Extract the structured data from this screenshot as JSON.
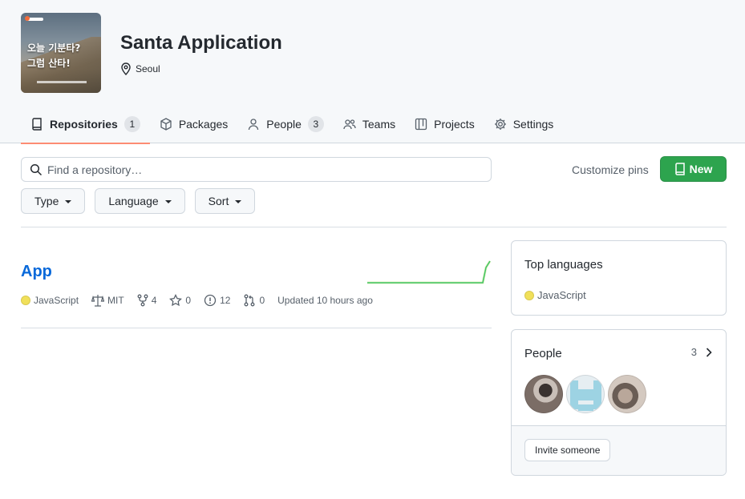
{
  "org": {
    "name": "Santa Application",
    "location": "Seoul",
    "avatar_text": [
      "오늘 기분타?",
      "그럼 산타!"
    ]
  },
  "tabs": [
    {
      "label": "Repositories",
      "count": "1",
      "icon": "repo-icon",
      "selected": true
    },
    {
      "label": "Packages",
      "icon": "package-icon"
    },
    {
      "label": "People",
      "count": "3",
      "icon": "person-icon"
    },
    {
      "label": "Teams",
      "icon": "people-icon"
    },
    {
      "label": "Projects",
      "icon": "table-icon"
    },
    {
      "label": "Settings",
      "icon": "gear-icon"
    }
  ],
  "search": {
    "placeholder": "Find a repository…"
  },
  "actions": {
    "customize": "Customize pins",
    "new": "New"
  },
  "filters": {
    "type": "Type",
    "language": "Language",
    "sort": "Sort"
  },
  "repo": {
    "name": "App",
    "language": "JavaScript",
    "license": "MIT",
    "forks": "4",
    "stars": "0",
    "issues": "12",
    "pulls": "0",
    "updated": "Updated 10 hours ago"
  },
  "top_languages": {
    "title": "Top languages",
    "items": [
      "JavaScript"
    ]
  },
  "people": {
    "title": "People",
    "count": "3",
    "invite": "Invite someone"
  },
  "colors": {
    "accent_green": "#2da44e",
    "link_blue": "#0969da",
    "tab_underline": "#fd8c73",
    "javascript": "#f1e05a"
  }
}
